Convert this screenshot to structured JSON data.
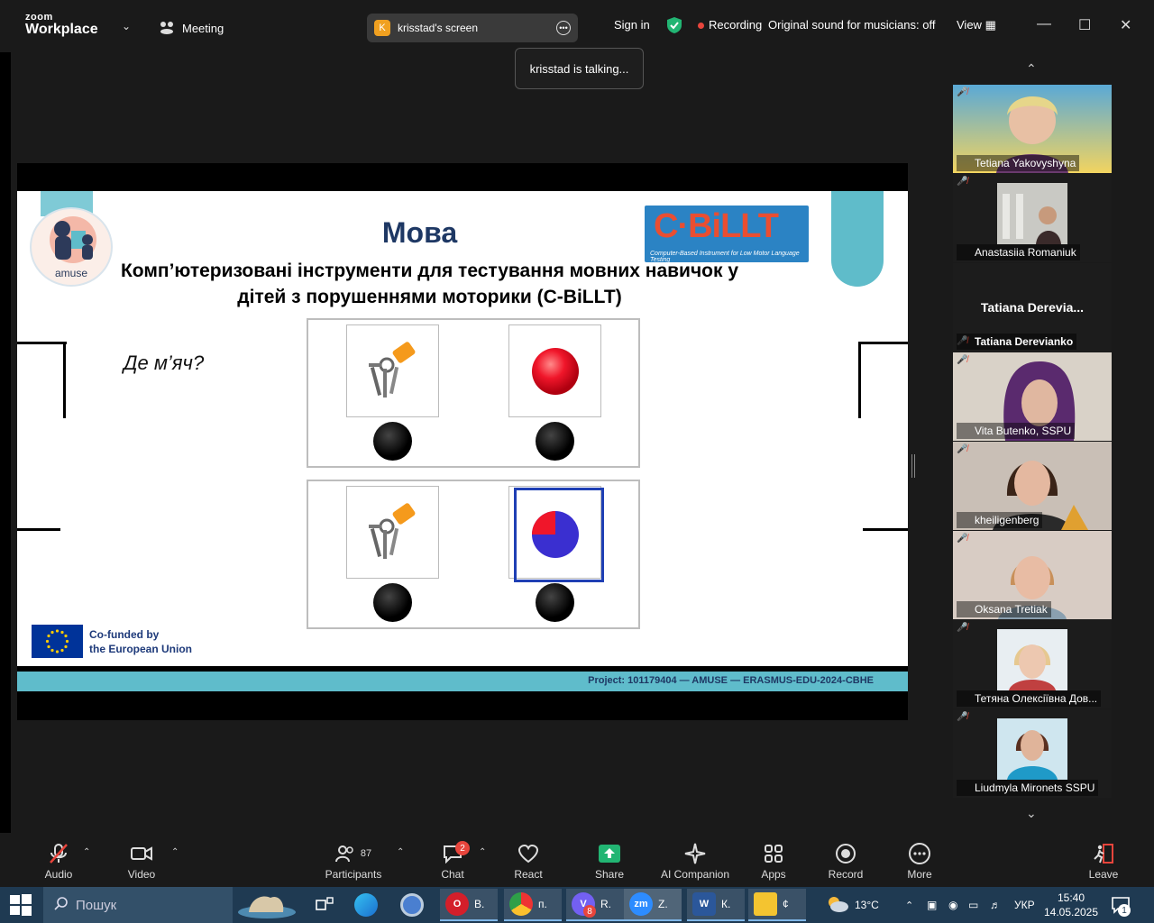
{
  "app": {
    "brand_top": "zoom",
    "brand_bottom": "Workplace",
    "meeting_label": "Meeting"
  },
  "screen_pill": {
    "avatar_letter": "K",
    "label": "krisstad's screen"
  },
  "header_right": {
    "sign_in": "Sign in",
    "recording": "Recording",
    "original_sound": "Original sound for musicians: off",
    "view": "View"
  },
  "tooltip": "krisstad is talking...",
  "slide": {
    "logo_text": "amuse",
    "title": "Мова",
    "subtitle": "Комп’ютеризовані інструменти для тестування мовних навичок у дітей з порушеннями моторики (C-BiLLT)",
    "cbillt_logo": "C·BiLLT",
    "cbillt_tag": "Computer-Based Instrument for Low Motor Language Testing",
    "question": "Де м’яч?",
    "eu_text_1": "Co-funded by",
    "eu_text_2": "the European Union",
    "footer": "Project: 101179404 — AMUSE — ERASMUS-EDU-2024-CBHE"
  },
  "participants": [
    {
      "name": "Tetiana Yakovyshyna",
      "muted": true
    },
    {
      "name": "Anastasiia Romaniuk",
      "muted": true
    },
    {
      "name": "Tatiana Derevianko",
      "display": "Tatiana  Derevia...",
      "muted": true
    },
    {
      "name": "Vita Butenko, SSPU",
      "muted": true
    },
    {
      "name": "kheiligenberg",
      "muted": true
    },
    {
      "name": "Oksana Tretiak",
      "muted": true
    },
    {
      "name": "Тетяна Олексіївна Дов...",
      "muted": true
    },
    {
      "name": "Liudmyla Mironets SSPU",
      "muted": true
    }
  ],
  "toolbar": {
    "audio": "Audio",
    "video": "Video",
    "participants": "Participants",
    "participants_count": "87",
    "chat": "Chat",
    "chat_badge": "2",
    "react": "React",
    "share": "Share",
    "ai_companion": "AI Companion",
    "apps": "Apps",
    "record": "Record",
    "more": "More",
    "leave": "Leave"
  },
  "taskbar": {
    "search_placeholder": "Пошук",
    "apps": [
      {
        "name": "opera",
        "label": "В."
      },
      {
        "name": "chrome",
        "label": "п."
      },
      {
        "name": "viber",
        "label": "R.",
        "badge": "8"
      },
      {
        "name": "zoom",
        "label": "Z."
      },
      {
        "name": "word",
        "label": "К."
      },
      {
        "name": "explorer",
        "label": "¢"
      }
    ],
    "weather": "13°C",
    "lang": "УКР",
    "time": "15:40",
    "date": "14.05.2025",
    "notif_count": "1"
  },
  "colors": {
    "accent_teal": "#5fbcca",
    "title_blue": "#1e3864",
    "select_blue": "#1f3fb4",
    "rec_red": "#e8453c",
    "share_green": "#22b573"
  }
}
